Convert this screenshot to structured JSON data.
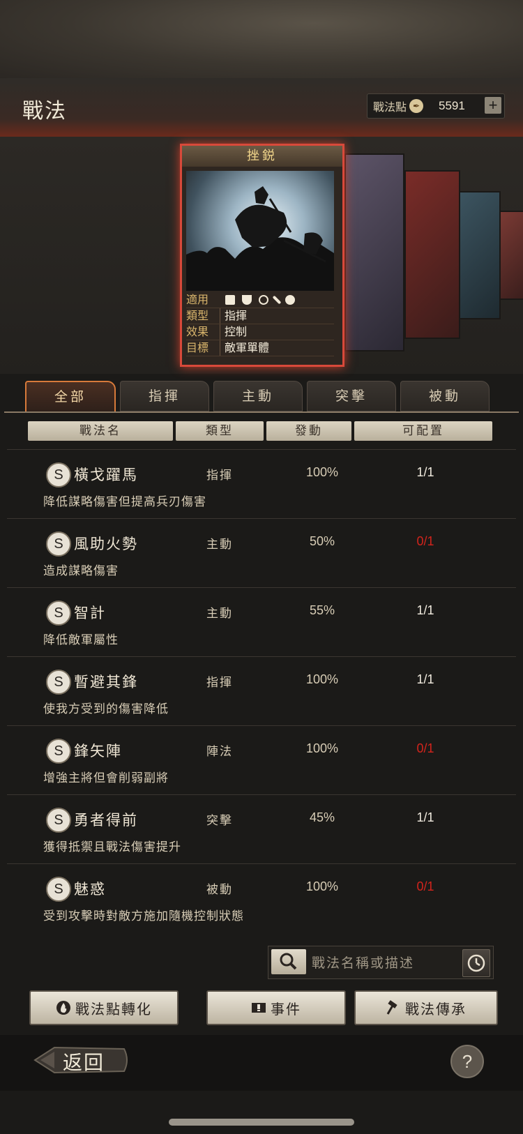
{
  "header": {
    "title": "戰法",
    "points_label": "戰法點",
    "points_value": "5591",
    "plus_label": "+"
  },
  "card": {
    "name": "挫鋭",
    "info": [
      {
        "key": "適用",
        "value": ""
      },
      {
        "key": "類型",
        "value": "指揮"
      },
      {
        "key": "效果",
        "value": "控制"
      },
      {
        "key": "目標",
        "value": "敵軍單體"
      }
    ],
    "applicable_icons": [
      "cavalry-icon",
      "shield-icon",
      "archer-icon",
      "spear-icon",
      "vehicle-icon"
    ]
  },
  "tabs": [
    {
      "label": "全部",
      "active": true
    },
    {
      "label": "指揮",
      "active": false
    },
    {
      "label": "主動",
      "active": false
    },
    {
      "label": "突擊",
      "active": false
    },
    {
      "label": "被動",
      "active": false
    }
  ],
  "columns": [
    "戰法名",
    "類型",
    "發動",
    "可配置"
  ],
  "tactics": [
    {
      "grade": "S",
      "name": "橫戈躍馬",
      "type": "指揮",
      "rate": "100%",
      "avail": "1/1",
      "desc": "降低謀略傷害但提高兵刃傷害"
    },
    {
      "grade": "S",
      "name": "風助火勢",
      "type": "主動",
      "rate": "50%",
      "avail": "0/1",
      "desc": "造成謀略傷害"
    },
    {
      "grade": "S",
      "name": "智計",
      "type": "主動",
      "rate": "55%",
      "avail": "1/1",
      "desc": "降低敵軍屬性"
    },
    {
      "grade": "S",
      "name": "暫避其鋒",
      "type": "指揮",
      "rate": "100%",
      "avail": "1/1",
      "desc": "使我方受到的傷害降低"
    },
    {
      "grade": "S",
      "name": "鋒矢陣",
      "type": "陣法",
      "rate": "100%",
      "avail": "0/1",
      "desc": "增強主將但會削弱副將"
    },
    {
      "grade": "S",
      "name": "勇者得前",
      "type": "突擊",
      "rate": "45%",
      "avail": "1/1",
      "desc": "獲得抵禦且戰法傷害提升"
    },
    {
      "grade": "S",
      "name": "魅惑",
      "type": "被動",
      "rate": "100%",
      "avail": "0/1",
      "desc": "受到攻擊時對敵方施加隨機控制狀態"
    }
  ],
  "search": {
    "placeholder": "戰法名稱或描述"
  },
  "buttons": {
    "convert": "戰法點轉化",
    "events": "事件",
    "inherit": "戰法傳承"
  },
  "footer": {
    "back": "返回",
    "help": "?"
  },
  "colors": {
    "accent_red": "#d3241c",
    "card_border": "#d8493a",
    "tab_active": "#d77a3a"
  }
}
